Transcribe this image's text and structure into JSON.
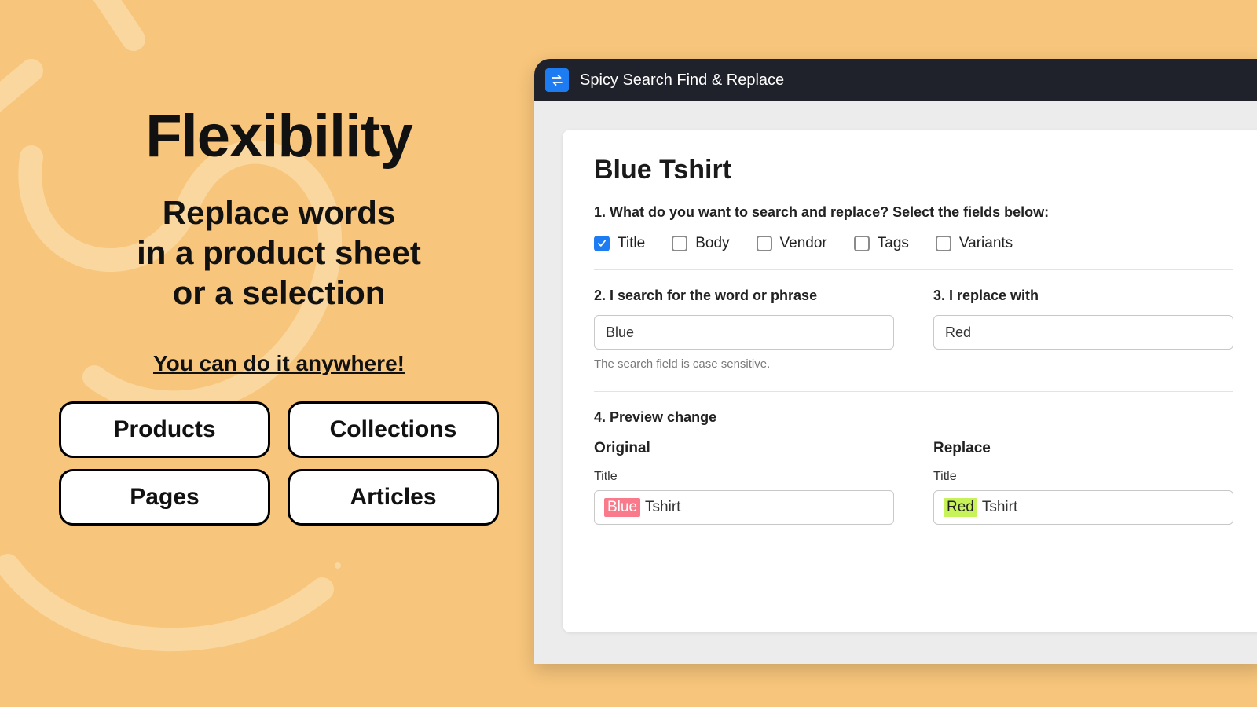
{
  "marketing": {
    "headline": "Flexibility",
    "subhead_l1": "Replace words",
    "subhead_l2": "in a product sheet",
    "subhead_l3": "or a selection",
    "tagline": "You can do it anywhere!",
    "pills": [
      "Products",
      "Collections",
      "Pages",
      "Articles"
    ]
  },
  "app": {
    "title": "Spicy Search Find & Replace",
    "product_title": "Blue Tshirt",
    "step1_label": "1. What do you want to search and replace? Select the fields below:",
    "fields": [
      {
        "label": "Title",
        "checked": true
      },
      {
        "label": "Body",
        "checked": false
      },
      {
        "label": "Vendor",
        "checked": false
      },
      {
        "label": "Tags",
        "checked": false
      },
      {
        "label": "Variants",
        "checked": false
      }
    ],
    "step2_label": "2. I search for the word or phrase",
    "search_value": "Blue",
    "search_hint": "The search field is case sensitive.",
    "step3_label": "3. I replace with",
    "replace_value": "Red",
    "step4_label": "4. Preview change",
    "preview": {
      "original_head": "Original",
      "replace_head": "Replace",
      "field_label": "Title",
      "original_hl": "Blue",
      "original_rest": "Tshirt",
      "replace_hl": "Red",
      "replace_rest": "Tshirt"
    }
  }
}
